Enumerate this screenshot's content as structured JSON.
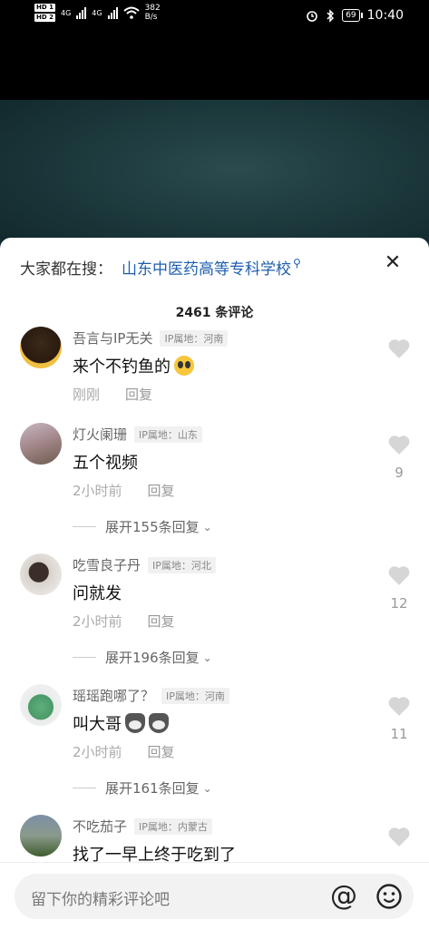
{
  "status_bar": {
    "hd1": "HD 1",
    "hd2": "HD 2",
    "net1": "4G",
    "net2": "4G",
    "speed_value": "382",
    "speed_unit": "B/s",
    "battery": "69",
    "time": "10:40"
  },
  "sheet": {
    "search_prefix": "大家都在搜：",
    "search_term": "山东中医药高等专科学校",
    "close_icon": "close-icon",
    "comment_count": "2461 条评论"
  },
  "comments": [
    {
      "user": "吾言与IP无关",
      "ip": "IP属地：河南",
      "text": "来个不钓鱼的",
      "emoji": "crying-face",
      "time": "刚刚",
      "reply": "回复",
      "likes": "",
      "expand": ""
    },
    {
      "user": "灯火阑珊",
      "ip": "IP属地：山东",
      "text": "五个视频",
      "emoji": "",
      "time": "2小时前",
      "reply": "回复",
      "likes": "9",
      "expand": "展开155条回复"
    },
    {
      "user": "吃雪良子丹",
      "ip": "IP属地：河北",
      "text": "问就发",
      "emoji": "",
      "time": "2小时前",
      "reply": "回复",
      "likes": "12",
      "expand": "展开196条回复"
    },
    {
      "user": "瑶瑶跑哪了？",
      "ip": "IP属地：河南",
      "text": "叫大哥",
      "emoji": "dog-face",
      "time": "2小时前",
      "reply": "回复",
      "likes": "11",
      "expand": "展开161条回复"
    },
    {
      "user": "不吃茄子",
      "ip": "IP属地：内蒙古",
      "text": "找了一早上终于吃到了",
      "emoji": "",
      "time": "",
      "reply": "",
      "likes": "",
      "expand": ""
    }
  ],
  "input": {
    "placeholder": "留下你的精彩评论吧",
    "at_label": "@"
  },
  "colors": {
    "link": "#1f5fae",
    "sheet_bg": "#ffffff",
    "video_bg": "#1d3a3d"
  }
}
